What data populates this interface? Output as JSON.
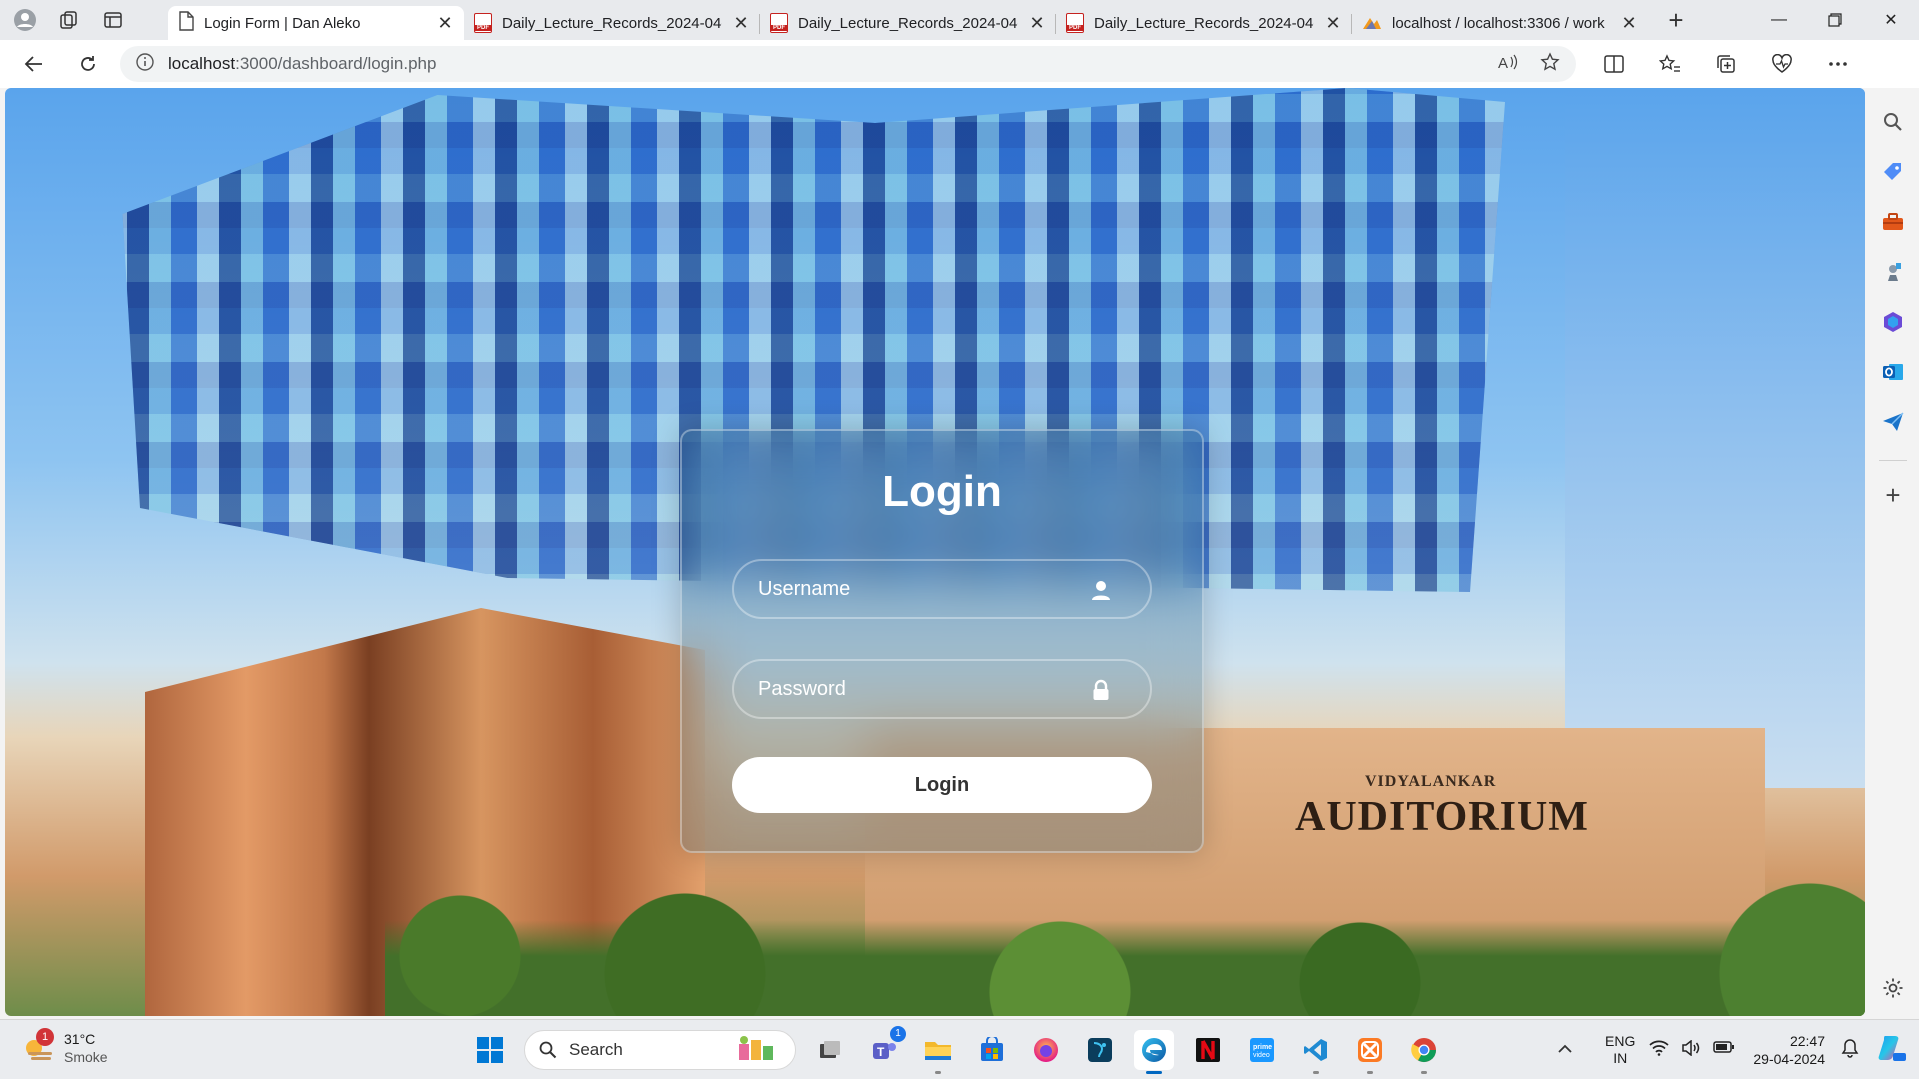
{
  "browser": {
    "tabs": [
      {
        "title": "Login Form | Dan Aleko",
        "icon": "page-icon",
        "active": true
      },
      {
        "title": "Daily_Lecture_Records_2024-04-",
        "icon": "pdf-icon",
        "active": false
      },
      {
        "title": "Daily_Lecture_Records_2024-04-",
        "icon": "pdf-icon",
        "active": false
      },
      {
        "title": "Daily_Lecture_Records_2024-04-",
        "icon": "pdf-icon",
        "active": false
      },
      {
        "title": "localhost / localhost:3306 / work",
        "icon": "phpmyadmin-icon",
        "active": false
      }
    ],
    "address": {
      "host": "localhost",
      "path": ":3000/dashboard/login.php"
    }
  },
  "login": {
    "title": "Login",
    "username_placeholder": "Username",
    "password_placeholder": "Password",
    "button_label": "Login"
  },
  "background": {
    "sign_small": "VIDYALANKAR",
    "sign_large": "AUDITORIUM"
  },
  "taskbar": {
    "weather": {
      "temp": "31°C",
      "condition": "Smoke",
      "badge": "1"
    },
    "search_label": "Search",
    "teams_badge": "1",
    "lang": {
      "line1": "ENG",
      "line2": "IN"
    },
    "clock": {
      "time": "22:47",
      "date": "29-04-2024"
    }
  },
  "colors": {
    "accent": "#0067c0",
    "tab_strip": "#e8eaed",
    "taskbar": "#eaecef"
  }
}
